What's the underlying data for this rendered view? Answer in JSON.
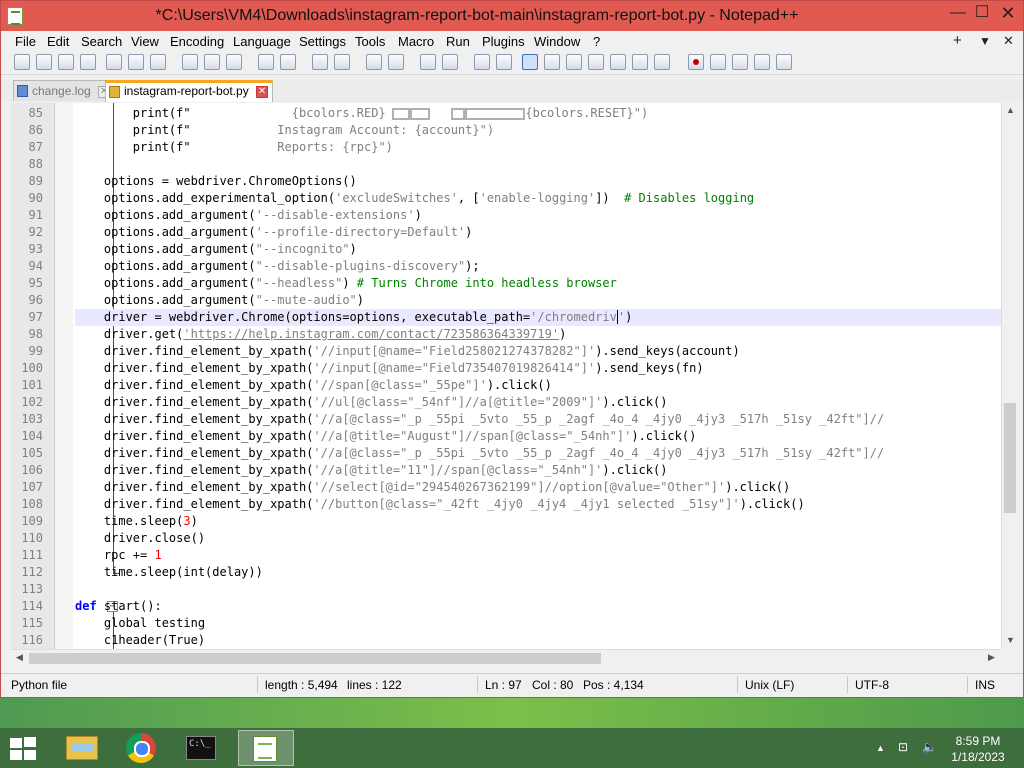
{
  "window": {
    "title": "*C:\\Users\\VM4\\Downloads\\instagram-report-bot-main\\instagram-report-bot.py - Notepad++",
    "minimize": "—",
    "maximize": "☐",
    "close": "✕"
  },
  "menu": {
    "items": [
      "File",
      "Edit",
      "Search",
      "View",
      "Encoding",
      "Language",
      "Settings",
      "Tools",
      "Macro",
      "Run",
      "Plugins",
      "Window",
      "?"
    ],
    "plus": "+",
    "dropdown": "▼",
    "close": "✕"
  },
  "tabs": [
    {
      "label": "change.log",
      "active": false
    },
    {
      "label": "instagram-report-bot.py",
      "active": true
    }
  ],
  "tab_close": "✕",
  "editor": {
    "language": "Python",
    "current_line": 97,
    "lines": [
      {
        "n": "85"
      },
      {
        "n": "86"
      },
      {
        "n": "87"
      },
      {
        "n": "88"
      },
      {
        "n": "89"
      },
      {
        "n": "90"
      },
      {
        "n": "91"
      },
      {
        "n": "92"
      },
      {
        "n": "93"
      },
      {
        "n": "94"
      },
      {
        "n": "95"
      },
      {
        "n": "96"
      },
      {
        "n": "97"
      },
      {
        "n": "98"
      },
      {
        "n": "99"
      },
      {
        "n": "100"
      },
      {
        "n": "101"
      },
      {
        "n": "102"
      },
      {
        "n": "103"
      },
      {
        "n": "104"
      },
      {
        "n": "105"
      },
      {
        "n": "106"
      },
      {
        "n": "107"
      },
      {
        "n": "108"
      },
      {
        "n": "109"
      },
      {
        "n": "110"
      },
      {
        "n": "111"
      },
      {
        "n": "112"
      },
      {
        "n": "113"
      },
      {
        "n": "114"
      },
      {
        "n": "115"
      },
      {
        "n": "116"
      }
    ],
    "code": {
      "l85": [
        "        ",
        "print",
        "(f\"",
        "              {bcolors.RED}",
        "   ",
        "{bcolors.RESET}\")"
      ],
      "l86": [
        "        ",
        "print",
        "(f\"",
        "            Instagram Account: {account}\")"
      ],
      "l87": [
        "        ",
        "print",
        "(f\"",
        "            Reports: {rpc}\")"
      ],
      "l89": [
        "    options = webdriver.ChromeOptions()"
      ],
      "l90": [
        "    options.add_experimental_option(",
        "'excludeSwitches'",
        ", [",
        "'enable-logging'",
        "])  ",
        "# Disables logging"
      ],
      "l91": [
        "    options.add_argument(",
        "'--disable-extensions'",
        ")"
      ],
      "l92": [
        "    options.add_argument(",
        "'--profile-directory=Default'",
        ")"
      ],
      "l93": [
        "    options.add_argument(",
        "\"--incognito\"",
        ")"
      ],
      "l94": [
        "    options.add_argument(",
        "\"--disable-plugins-discovery\"",
        ");"
      ],
      "l95": [
        "    options.add_argument(",
        "\"--headless\"",
        ") ",
        "# Turns Chrome into headless browser"
      ],
      "l96": [
        "    options.add_argument(",
        "\"--mute-audio\"",
        ")"
      ],
      "l97": [
        "    driver = webdriver.Chrome(options=options, executable_path=",
        "'/chromedriv",
        "'",
        ")"
      ],
      "l98": [
        "    driver.get(",
        "'https://help.instagram.com/contact/723586364339719'",
        ")"
      ],
      "l99": [
        "    driver.find_element_by_xpath(",
        "'//input[@name=\"Field258021274378282\"]'",
        ").send_keys(account)"
      ],
      "l100": [
        "    driver.find_element_by_xpath(",
        "'//input[@name=\"Field735407019826414\"]'",
        ").send_keys(fn)"
      ],
      "l101": [
        "    driver.find_element_by_xpath(",
        "'//span[@class=\"_55pe\"]'",
        ").click()"
      ],
      "l102": [
        "    driver.find_element_by_xpath(",
        "'//ul[@class=\"_54nf\"]//a[@title=\"2009\"]'",
        ").click()"
      ],
      "l103": [
        "    driver.find_element_by_xpath(",
        "'//a[@class=\"_p _55pi _5vto _55_p _2agf _4o_4 _4jy0 _4jy3 _517h _51sy _42ft\"]//"
      ],
      "l104": [
        "    driver.find_element_by_xpath(",
        "'//a[@title=\"August\"]//span[@class=\"_54nh\"]'",
        ").click()"
      ],
      "l105": [
        "    driver.find_element_by_xpath(",
        "'//a[@class=\"_p _55pi _5vto _55_p _2agf _4o_4 _4jy0 _4jy3 _517h _51sy _42ft\"]//"
      ],
      "l106": [
        "    driver.find_element_by_xpath(",
        "'//a[@title=\"11\"]//span[@class=\"_54nh\"]'",
        ").click()"
      ],
      "l107": [
        "    driver.find_element_by_xpath(",
        "'//select[@id=\"294540267362199\"]//option[@value=\"Other\"]'",
        ").click()"
      ],
      "l108": [
        "    driver.find_element_by_xpath(",
        "'//button[@class=\"_42ft _4jy0 _4jy4 _4jy1 selected _51sy\"]'",
        ").click()"
      ],
      "l109": [
        "    time.sleep(",
        "3",
        ")"
      ],
      "l110": [
        "    driver.close()"
      ],
      "l111": [
        "    rpc += ",
        "1"
      ],
      "l112": [
        "    time.sleep(int(delay))"
      ],
      "l114": [
        "def",
        " start",
        "():"
      ],
      "l115": [
        "    global testing"
      ],
      "l116": [
        "    c1header(True)"
      ]
    }
  },
  "status": {
    "file_type": "Python file",
    "length": "length : 5,494",
    "lines": "lines : 122",
    "ln": "Ln : 97",
    "col": "Col : 80",
    "pos": "Pos : 4,134",
    "eol": "Unix (LF)",
    "encoding": "UTF-8",
    "mode": "INS"
  },
  "taskbar": {
    "cmd_text": "C:\\_",
    "tray_up": "▲",
    "tray_network": "⊡",
    "tray_sound": "🔈",
    "time": "8:59 PM",
    "date": "1/18/2023"
  },
  "colors": {
    "title_bar": "#e15a52",
    "keyword": "#0000ff",
    "string": "#808080",
    "comment": "#008000",
    "number": "#ff0000",
    "current_line": "#e8e8ff"
  }
}
